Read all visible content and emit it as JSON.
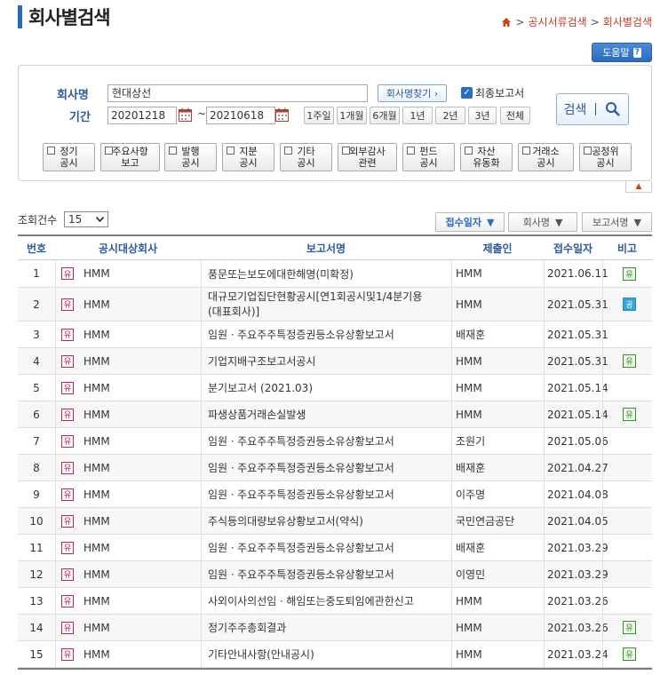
{
  "page": {
    "title": "회사별검색"
  },
  "breadcrumb": {
    "items": [
      "공시서류검색",
      "회사별검색"
    ]
  },
  "help": {
    "label": "도움말"
  },
  "form": {
    "company_label": "회사명",
    "company_value": "현대상선",
    "find_company_label": "회사명찾기 ›",
    "final_report_label": "최종보고서",
    "final_report_checked": true,
    "period_label": "기간",
    "start_date": "20201218",
    "end_date": "20210618",
    "tilde": "~",
    "period_buttons": [
      "1주일",
      "1개월",
      "6개월",
      "1년",
      "2년",
      "3년",
      "전체"
    ],
    "search_label": "검색",
    "types": [
      [
        "정기",
        "공시"
      ],
      [
        "주요사항",
        "보고"
      ],
      [
        "발행",
        "공시"
      ],
      [
        "지분",
        "공시"
      ],
      [
        "기타",
        "공시"
      ],
      [
        "외부감사",
        "관련"
      ],
      [
        "펀드",
        "공시"
      ],
      [
        "자산",
        "유동화"
      ],
      [
        "거래소",
        "공시"
      ],
      [
        "공정위",
        "공시"
      ]
    ]
  },
  "list_controls": {
    "count_label": "조회건수",
    "count_value": "15",
    "sort": [
      {
        "label": "접수일자",
        "active": true
      },
      {
        "label": "회사명",
        "active": false
      },
      {
        "label": "보고서명",
        "active": false
      }
    ]
  },
  "table": {
    "headers": [
      "번호",
      "공시대상회사",
      "보고서명",
      "제출인",
      "접수일자",
      "비고"
    ],
    "market_tag": "유",
    "rows": [
      {
        "no": "1",
        "company": "HMM",
        "report": "풍문또는보도에대한해명(미확정)",
        "report2": "",
        "submitter": "HMM",
        "date": "2021.06.11",
        "note": "유",
        "note_color": "green"
      },
      {
        "no": "2",
        "company": "HMM",
        "report": "대규모기업집단현황공시[연1회공시및1/4분기용",
        "report2": "(대표회사)]",
        "submitter": "HMM",
        "date": "2021.05.31",
        "note": "공",
        "note_color": "blue"
      },
      {
        "no": "3",
        "company": "HMM",
        "report": "임원ㆍ주요주주특정증권등소유상황보고서",
        "report2": "",
        "submitter": "배재훈",
        "date": "2021.05.31",
        "note": "",
        "note_color": ""
      },
      {
        "no": "4",
        "company": "HMM",
        "report": "기업지배구조보고서공시",
        "report2": "",
        "submitter": "HMM",
        "date": "2021.05.31",
        "note": "유",
        "note_color": "green"
      },
      {
        "no": "5",
        "company": "HMM",
        "report": "분기보고서 (2021.03)",
        "report2": "",
        "submitter": "HMM",
        "date": "2021.05.14",
        "note": "",
        "note_color": ""
      },
      {
        "no": "6",
        "company": "HMM",
        "report": "파생상품거래손실발생",
        "report2": "",
        "submitter": "HMM",
        "date": "2021.05.14",
        "note": "유",
        "note_color": "green"
      },
      {
        "no": "7",
        "company": "HMM",
        "report": "임원ㆍ주요주주특정증권등소유상황보고서",
        "report2": "",
        "submitter": "조원기",
        "date": "2021.05.06",
        "note": "",
        "note_color": ""
      },
      {
        "no": "8",
        "company": "HMM",
        "report": "임원ㆍ주요주주특정증권등소유상황보고서",
        "report2": "",
        "submitter": "배재훈",
        "date": "2021.04.27",
        "note": "",
        "note_color": ""
      },
      {
        "no": "9",
        "company": "HMM",
        "report": "임원ㆍ주요주주특정증권등소유상황보고서",
        "report2": "",
        "submitter": "이주명",
        "date": "2021.04.08",
        "note": "",
        "note_color": ""
      },
      {
        "no": "10",
        "company": "HMM",
        "report": "주식등의대량보유상황보고서(약식)",
        "report2": "",
        "submitter": "국민연금공단",
        "date": "2021.04.05",
        "note": "",
        "note_color": ""
      },
      {
        "no": "11",
        "company": "HMM",
        "report": "임원ㆍ주요주주특정증권등소유상황보고서",
        "report2": "",
        "submitter": "배재훈",
        "date": "2021.03.29",
        "note": "",
        "note_color": ""
      },
      {
        "no": "12",
        "company": "HMM",
        "report": "임원ㆍ주요주주특정증권등소유상황보고서",
        "report2": "",
        "submitter": "이영민",
        "date": "2021.03.29",
        "note": "",
        "note_color": ""
      },
      {
        "no": "13",
        "company": "HMM",
        "report": "사외이사의선임ㆍ해임또는중도퇴임에관한신고",
        "report2": "",
        "submitter": "HMM",
        "date": "2021.03.26",
        "note": "",
        "note_color": ""
      },
      {
        "no": "14",
        "company": "HMM",
        "report": "정기주주총회결과",
        "report2": "",
        "submitter": "HMM",
        "date": "2021.03.26",
        "note": "유",
        "note_color": "green"
      },
      {
        "no": "15",
        "company": "HMM",
        "report": "기타안내사항(안내공시)",
        "report2": "",
        "submitter": "HMM",
        "date": "2021.03.24",
        "note": "유",
        "note_color": "green"
      }
    ]
  }
}
